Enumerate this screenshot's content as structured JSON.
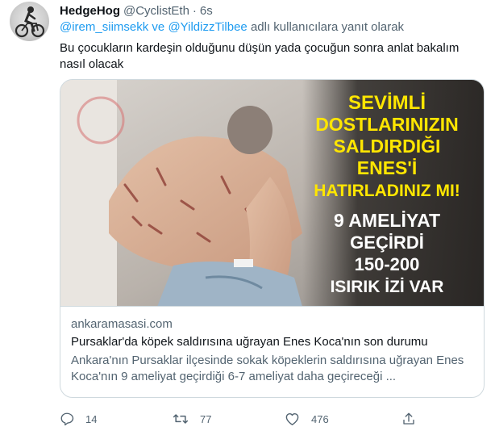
{
  "author": {
    "display_name": "HedgeHog",
    "handle": "@CyclistEth",
    "separator": "·",
    "time": "6s"
  },
  "reply_context": {
    "mention_1": "@irem_siimsekk",
    "connector": "ve",
    "mention_2": "@YildizzTilbee",
    "suffix": "adlı kullanıcılara yanıt olarak"
  },
  "tweet": {
    "text": "Bu çocukların kardeşin olduğunu düşün yada çocuğun sonra anlat bakalım nasıl olacak"
  },
  "card": {
    "image_text": {
      "line1": "SEVİMLİ",
      "line2": "DOSTLARINIZIN",
      "line3": "SALDIRDIĞI",
      "line4": "ENES'İ",
      "line5": "HATIRLADINIZ MI!",
      "line6": "9 AMELİYAT",
      "line7": "GEÇİRDİ",
      "line8": "150-200",
      "line9": "ISIRIK İZİ VAR"
    },
    "domain": "ankaramasasi.com",
    "title": "Pursaklar'da köpek saldırısına uğrayan Enes Koca'nın son durumu",
    "description": "Ankara'nın Pursaklar ilçesinde sokak köpeklerin saldırısına uğrayan Enes Koca'nın 9 ameliyat geçirdiği 6-7 ameliyat daha geçireceği ..."
  },
  "actions": {
    "reply": {
      "icon": "reply-icon",
      "count": "14"
    },
    "retweet": {
      "icon": "retweet-icon",
      "count": "77"
    },
    "like": {
      "icon": "heart-icon",
      "count": "476"
    },
    "share": {
      "icon": "share-icon"
    }
  },
  "colors": {
    "text": "#0f1419",
    "secondary": "#536471",
    "link": "#1d9bf0",
    "border": "#cfd9de",
    "overlay_text": "#ffe600"
  }
}
